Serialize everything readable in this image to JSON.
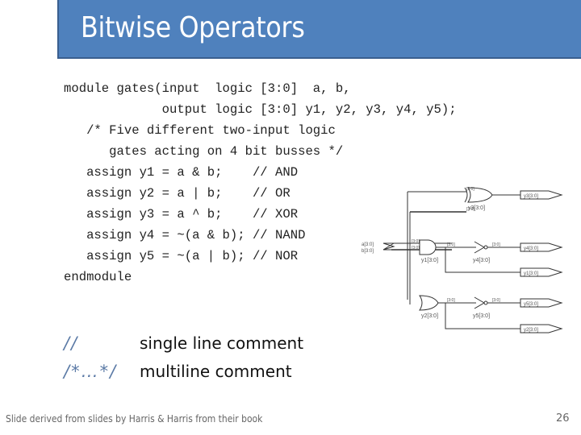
{
  "slide": {
    "title": "Bitwise Operators",
    "code_lines": [
      "module gates(input  logic [3:0]  a, b,",
      "             output logic [3:0] y1, y2, y3, y4, y5);",
      "   /* Five different two-input logic",
      "      gates acting on 4 bit busses */",
      "   assign y1 = a & b;    // AND",
      "   assign y2 = a | b;    // OR",
      "   assign y3 = a ^ b;    // XOR",
      "   assign y4 = ~(a & b); // NAND",
      "   assign y5 = ~(a | b); // NOR",
      "endmodule"
    ],
    "legend": [
      {
        "symbol": "//",
        "description": "single line comment"
      },
      {
        "symbol": "/*…*/",
        "description": "multiline comment"
      }
    ],
    "footer": "Slide derived from slides by Harris & Harris from their book",
    "page_number": "26"
  },
  "schematic": {
    "inputs": [
      "a[3:0]",
      "b[3:0]"
    ],
    "gates": [
      {
        "type": "xor",
        "label": "y3[3:0]"
      },
      {
        "type": "and",
        "label": "y1[3:0]"
      },
      {
        "type": "not",
        "label": "y4[3:0]"
      },
      {
        "type": "or",
        "label": "y2[3:0]"
      },
      {
        "type": "not",
        "label": "y5[3:0]"
      }
    ],
    "outputs": [
      "y3[3:0]",
      "y4[3:0]",
      "y1[3:0]",
      "y5[3:0]",
      "y2[3:0]"
    ],
    "bus_tag": "[3:0]"
  },
  "colors": {
    "title_fill": "#4f81bd",
    "title_border": "#3a5f8f",
    "comment_symbol": "#5b7aa6"
  }
}
